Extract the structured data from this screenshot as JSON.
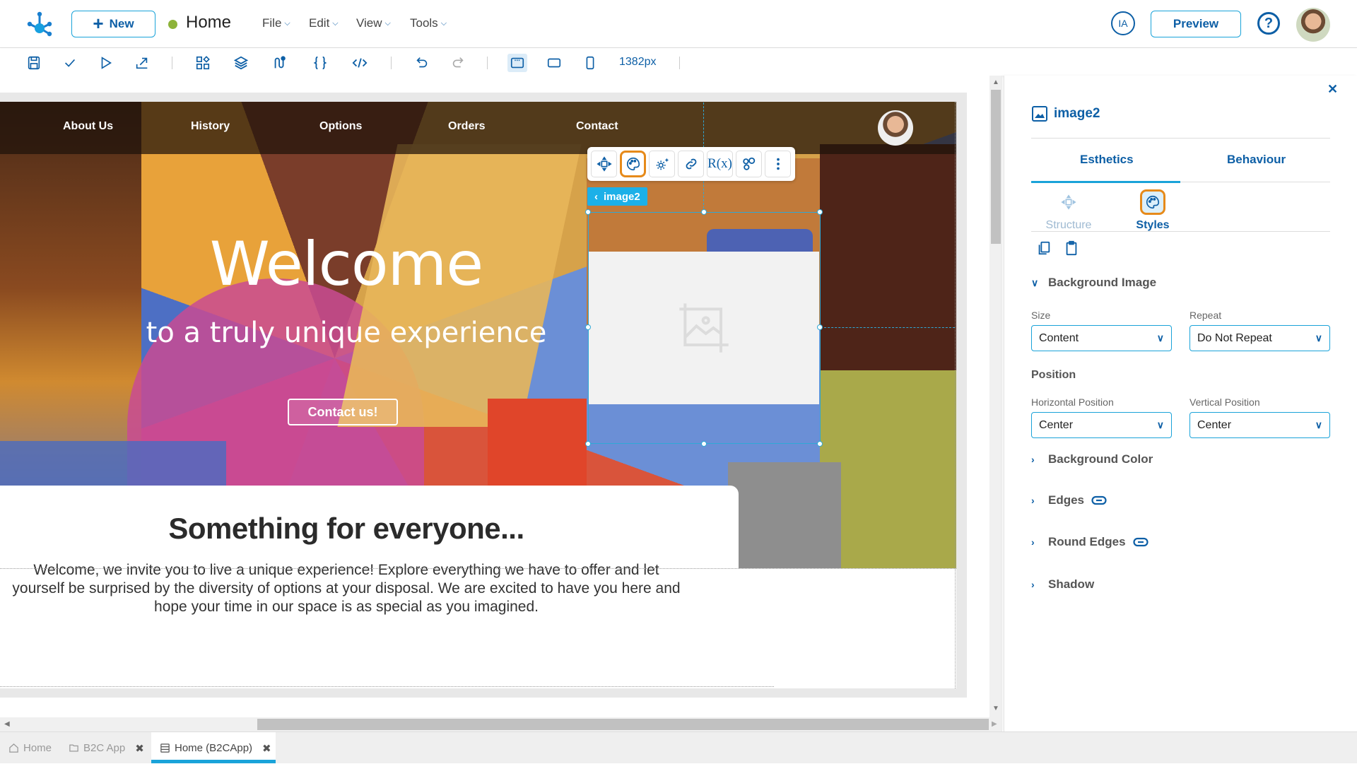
{
  "header": {
    "new_label": "New",
    "page_title": "Home",
    "status_color": "#8db33a",
    "menus": [
      "File",
      "Edit",
      "View",
      "Tools"
    ],
    "ia_label": "IA",
    "preview_label": "Preview",
    "help_label": "?"
  },
  "toolbar": {
    "icons": [
      "save-icon",
      "check-icon",
      "play-icon",
      "export-icon",
      "components-icon",
      "layers-icon",
      "flows-icon",
      "braces-icon",
      "code-icon",
      "undo-icon",
      "redo-icon",
      "desktop-view-icon",
      "tablet-view-icon",
      "mobile-view-icon"
    ],
    "width_readout": "1382px"
  },
  "canvas": {
    "nav_links": [
      "About Us",
      "History",
      "Options",
      "Orders",
      "Contact"
    ],
    "hero_title": "Welcome",
    "hero_subtitle": "to a truly unique experience",
    "hero_button": "Contact us!",
    "card_title": "Something for everyone...",
    "card_text": "Welcome, we invite you to live a unique experience! Explore everything we have to offer and let yourself be surprised by the diversity of options at your disposal. We are excited to have you here and hope your time in our space is as special as you imagined.",
    "selected_element": "image2",
    "floating_toolbar": [
      "move-icon",
      "palette-icon",
      "settings-sparkle-icon",
      "link-icon",
      "regex-icon",
      "nodes-icon",
      "more-vertical-icon"
    ],
    "regex_label": "R(x)"
  },
  "panel": {
    "title": "image2",
    "tabs": [
      "Esthetics",
      "Behaviour"
    ],
    "active_tab": "Esthetics",
    "subtabs": [
      "Structure",
      "Styles"
    ],
    "active_subtab": "Styles",
    "sections": {
      "background_image": "Background Image",
      "size_label": "Size",
      "size_value": "Content",
      "repeat_label": "Repeat",
      "repeat_value": "Do Not Repeat",
      "position_label": "Position",
      "hpos_label": "Horizontal Position",
      "hpos_value": "Center",
      "vpos_label": "Vertical Position",
      "vpos_value": "Center",
      "background_color": "Background Color",
      "edges": "Edges",
      "round_edges": "Round Edges",
      "shadow": "Shadow"
    }
  },
  "bottom_tabs": [
    {
      "label": "Home",
      "closable": false
    },
    {
      "label": "B2C App",
      "closable": true
    },
    {
      "label": "Home (B2CApp)",
      "closable": true,
      "active": true
    }
  ],
  "colors": {
    "accent": "#0d5fa6",
    "highlight": "#e68a1a",
    "selection": "#1cb0e8"
  }
}
